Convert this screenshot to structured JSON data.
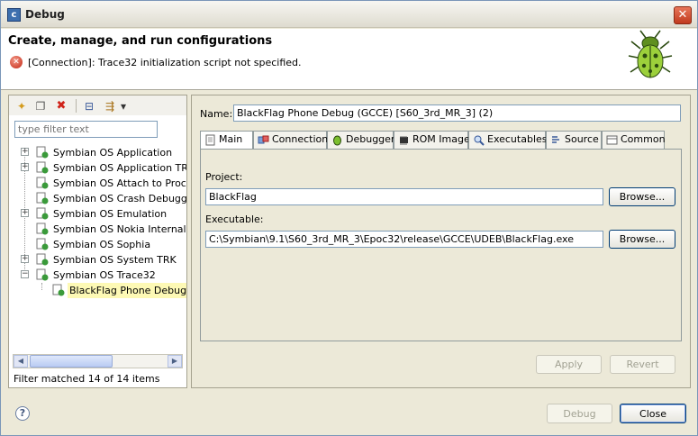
{
  "window": {
    "title": "Debug",
    "close_glyph": "✕"
  },
  "header": {
    "title": "Create, manage, and run configurations",
    "error_message": "[Connection]: Trace32 initialization script not specified.",
    "error_icon": "error-icon",
    "banner_icon": "bug-icon"
  },
  "left": {
    "toolbar": [
      {
        "name": "new-configuration-icon",
        "glyph": "✦"
      },
      {
        "name": "duplicate-icon",
        "glyph": "❐"
      },
      {
        "name": "delete-icon",
        "glyph": "✖"
      },
      {
        "name": "collapse-all-icon",
        "glyph": "⊟"
      },
      {
        "name": "filter-icon",
        "glyph": "⇶"
      },
      {
        "name": "view-menu-icon",
        "glyph": "▾"
      }
    ],
    "filter_placeholder": "type filter text",
    "tree": [
      {
        "label": "Symbian OS Application",
        "expander": "+"
      },
      {
        "label": "Symbian OS Application TRK",
        "expander": "+"
      },
      {
        "label": "Symbian OS Attach to Process",
        "expander": ""
      },
      {
        "label": "Symbian OS Crash Debugger",
        "expander": ""
      },
      {
        "label": "Symbian OS Emulation",
        "expander": "+"
      },
      {
        "label": "Symbian OS Nokia Internal Tra",
        "expander": ""
      },
      {
        "label": "Symbian OS Sophia",
        "expander": ""
      },
      {
        "label": "Symbian OS System TRK",
        "expander": "+"
      },
      {
        "label": "Symbian OS Trace32",
        "expander": "−"
      }
    ],
    "selected_child": "BlackFlag Phone Debug (G",
    "filter_status": "Filter matched 14 of 14 items"
  },
  "config": {
    "name_label": "Name:",
    "name_value": "BlackFlag Phone Debug (GCCE) [S60_3rd_MR_3] (2)",
    "tabs": [
      {
        "label": "Main",
        "icon": "main-tab-icon",
        "active": true
      },
      {
        "label": "Connection",
        "icon": "connection-tab-icon",
        "active": false
      },
      {
        "label": "Debugger",
        "icon": "debugger-tab-icon",
        "active": false
      },
      {
        "label": "ROM Image",
        "icon": "rom-image-tab-icon",
        "active": false
      },
      {
        "label": "Executables",
        "icon": "executables-tab-icon",
        "active": false
      },
      {
        "label": "Source",
        "icon": "source-tab-icon",
        "active": false
      },
      {
        "label": "Common",
        "icon": "common-tab-icon",
        "active": false
      }
    ],
    "project_label": "Project:",
    "project_value": "BlackFlag",
    "executable_label": "Executable:",
    "executable_value": "C:\\Symbian\\9.1\\S60_3rd_MR_3\\Epoc32\\release\\GCCE\\UDEB\\BlackFlag.exe",
    "browse_label": "Browse...",
    "apply_label": "Apply",
    "revert_label": "Revert"
  },
  "footer": {
    "help_glyph": "?",
    "debug_label": "Debug",
    "close_label": "Close"
  }
}
